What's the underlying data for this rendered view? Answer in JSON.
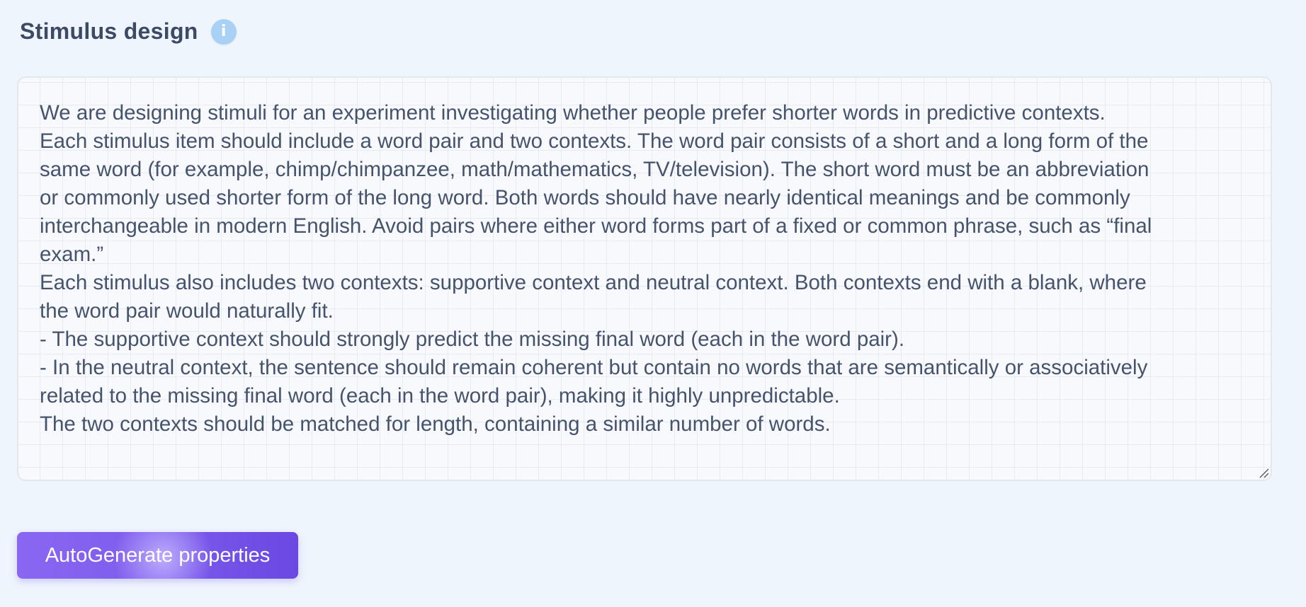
{
  "section": {
    "title": "Stimulus design",
    "info_icon_glyph": "i",
    "info_icon": "info-icon"
  },
  "editor": {
    "lines": [
      "We are designing stimuli for an experiment investigating whether people prefer shorter words in predictive contexts.",
      "Each stimulus item should include a word pair and two contexts. The word pair consists of a short and a long form of the",
      "same word (for example, chimp/chimpanzee, math/mathematics, TV/television). The short word must be an abbreviation",
      "or commonly used shorter form of the long word. Both words should have nearly identical meanings and be commonly",
      "interchangeable in modern English. Avoid pairs where either word forms part of a fixed or common phrase, such as “final",
      "exam.”",
      "Each stimulus also includes two contexts: supportive context and neutral context. Both contexts end with a blank, where",
      "the word pair would naturally fit.",
      "- The supportive context should strongly predict the missing final word (each in the word pair).",
      "- In the neutral context, the sentence should remain coherent but contain no words that are semantically or associatively",
      "related to the missing final word (each in the word pair), making it highly unpredictable.",
      "The two contexts should be matched for length, containing a similar number of words."
    ]
  },
  "actions": {
    "autogenerate_label": "AutoGenerate properties"
  },
  "colors": {
    "background": "#eff5fd",
    "title": "#3d4a66",
    "text": "#46536c",
    "info_icon": "#a9d1f5",
    "button_start": "#8a67f2",
    "button_end": "#6a48e2"
  }
}
